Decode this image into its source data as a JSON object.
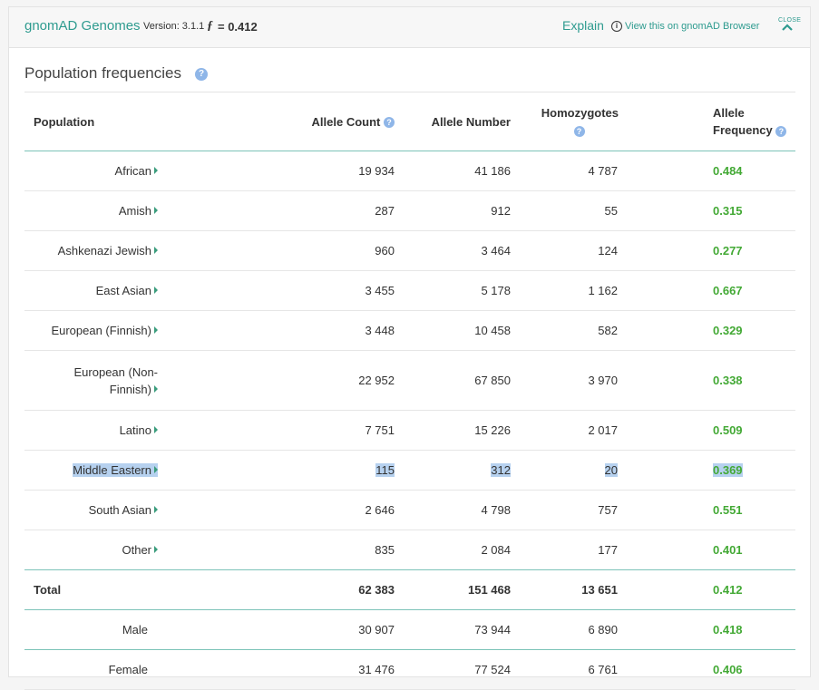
{
  "header": {
    "title": "gnomAD Genomes",
    "version_label": "Version: 3.1.1",
    "f_symbol": "ƒ",
    "f_value": "= 0.412",
    "explain_label": "Explain",
    "info_icon_glyph": "i",
    "browser_link": "View this on gnomAD Browser",
    "close_label": "CLOSE",
    "chevron_icon": "chevron-up-icon"
  },
  "section": {
    "title": "Population frequencies",
    "help_glyph": "?"
  },
  "table": {
    "columns": {
      "population": "Population",
      "allele_count": "Allele Count",
      "allele_number": "Allele Number",
      "homozygotes": "Homozygotes",
      "allele_frequency_line1": "Allele",
      "allele_frequency_line2": "Frequency"
    },
    "rows": [
      {
        "population": "African",
        "ac": "19 934",
        "an": "41 186",
        "hom": "4 787",
        "af": "0.484"
      },
      {
        "population": "Amish",
        "ac": "287",
        "an": "912",
        "hom": "55",
        "af": "0.315"
      },
      {
        "population": "Ashkenazi Jewish",
        "ac": "960",
        "an": "3 464",
        "hom": "124",
        "af": "0.277"
      },
      {
        "population": "East Asian",
        "ac": "3 455",
        "an": "5 178",
        "hom": "1 162",
        "af": "0.667"
      },
      {
        "population": "European (Finnish)",
        "ac": "3 448",
        "an": "10 458",
        "hom": "582",
        "af": "0.329"
      },
      {
        "population_line1": "European (Non-",
        "population_line2": "Finnish)",
        "ac": "22 952",
        "an": "67 850",
        "hom": "3 970",
        "af": "0.338"
      },
      {
        "population": "Latino",
        "ac": "7 751",
        "an": "15 226",
        "hom": "2 017",
        "af": "0.509"
      },
      {
        "population": "Middle Eastern",
        "ac": "115",
        "an": "312",
        "hom": "20",
        "af": "0.369"
      },
      {
        "population": "South Asian",
        "ac": "2 646",
        "an": "4 798",
        "hom": "757",
        "af": "0.551"
      },
      {
        "population": "Other",
        "ac": "835",
        "an": "2 084",
        "hom": "177",
        "af": "0.401"
      }
    ],
    "total": {
      "label": "Total",
      "ac": "62 383",
      "an": "151 468",
      "hom": "13 651",
      "af": "0.412"
    },
    "male": {
      "label": "Male",
      "ac": "30 907",
      "an": "73 944",
      "hom": "6 890",
      "af": "0.418"
    },
    "female": {
      "label": "Female",
      "ac": "31 476",
      "an": "77 524",
      "hom": "6 761",
      "af": "0.406"
    }
  },
  "colors": {
    "accent": "#2e9b8f",
    "frequency_green": "#43a935",
    "help_icon": "#8fb6e8",
    "selection_highlight": "#b6d1ef"
  }
}
